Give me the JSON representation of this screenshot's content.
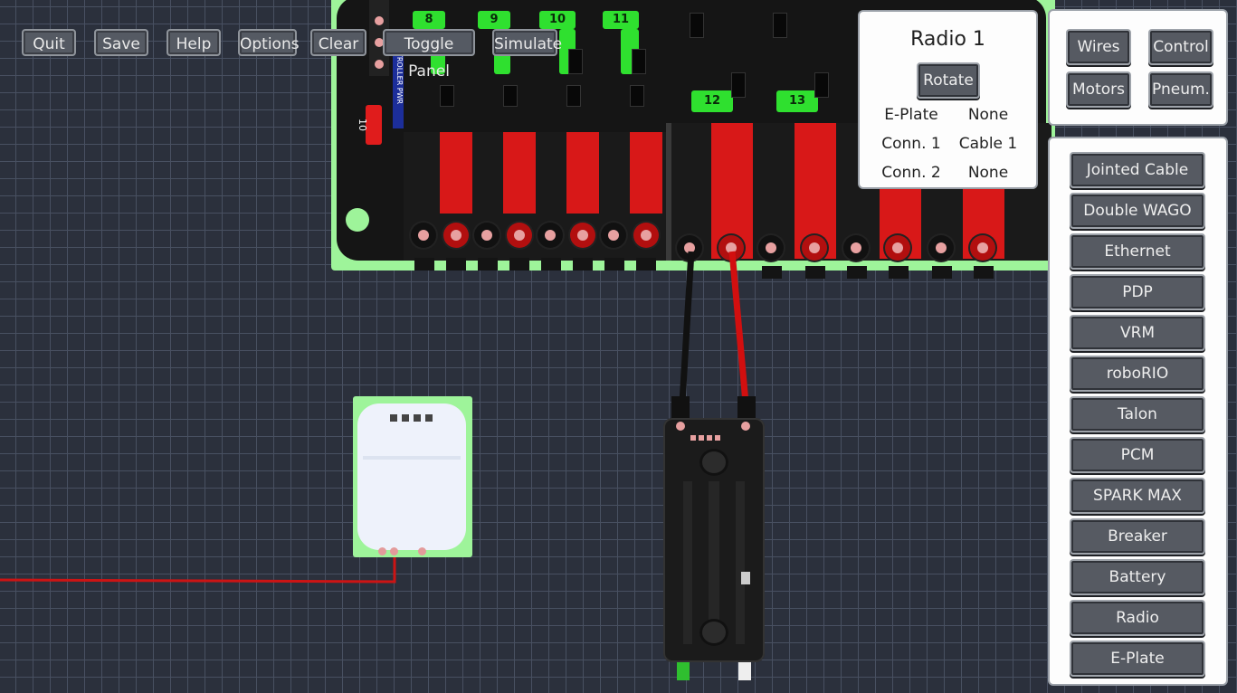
{
  "toolbar": {
    "quit": "Quit",
    "save": "Save",
    "help": "Help",
    "options": "Options",
    "clear": "Clear",
    "toggle_panel": "Toggle Panel",
    "simulate": "Simulate"
  },
  "properties": {
    "title": "Radio 1",
    "rotate": "Rotate",
    "rows": [
      {
        "key": "E-Plate",
        "value": "None"
      },
      {
        "key": "Conn. 1",
        "value": "Cable 1"
      },
      {
        "key": "Conn. 2",
        "value": "None"
      }
    ]
  },
  "categories": {
    "wires": "Wires",
    "control": "Control",
    "motors": "Motors",
    "pneum": "Pneum."
  },
  "components": {
    "items": [
      "Jointed Cable",
      "Double WAGO",
      "Ethernet",
      "PDP",
      "VRM",
      "roboRIO",
      "Talon",
      "PCM",
      "SPARK MAX",
      "Breaker",
      "Battery",
      "Radio",
      "E-Plate"
    ]
  },
  "board": {
    "slot_labels": [
      "8",
      "9",
      "10",
      "11",
      "12",
      "13"
    ],
    "fuse_label": "10",
    "vertical_label": "NTROLLER PWR"
  },
  "colors": {
    "board_green": "#9ef49a",
    "label_green": "#2fe02f",
    "wire_red": "#d81818",
    "background": "#2b303c"
  }
}
